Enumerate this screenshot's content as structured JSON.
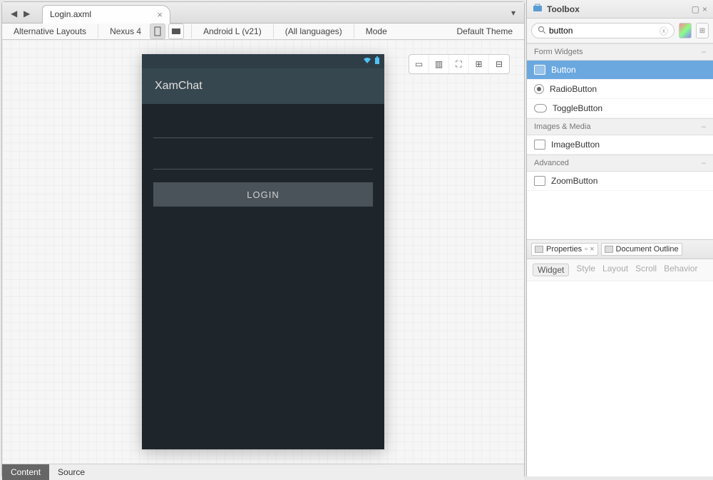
{
  "tab": {
    "filename": "Login.axml"
  },
  "toolbar": {
    "alt_layouts": "Alternative Layouts",
    "device": "Nexus 4",
    "android": "Android L (v21)",
    "languages": "(All languages)",
    "mode": "Mode",
    "theme": "Default Theme"
  },
  "phone": {
    "app_title": "XamChat",
    "login_btn": "LOGIN"
  },
  "bottom_tabs": {
    "content": "Content",
    "source": "Source"
  },
  "toolbox": {
    "title": "Toolbox",
    "search_value": "button",
    "categories": [
      {
        "name": "Form Widgets",
        "items": [
          {
            "label": "Button",
            "icon": "button",
            "selected": true
          },
          {
            "label": "RadioButton",
            "icon": "radio",
            "selected": false
          },
          {
            "label": "ToggleButton",
            "icon": "toggle",
            "selected": false
          }
        ]
      },
      {
        "name": "Images & Media",
        "items": [
          {
            "label": "ImageButton",
            "icon": "button",
            "selected": false
          }
        ]
      },
      {
        "name": "Advanced",
        "items": [
          {
            "label": "ZoomButton",
            "icon": "button",
            "selected": false
          }
        ]
      }
    ]
  },
  "properties": {
    "title": "Properties",
    "doc_outline": "Document Outline",
    "tabs": [
      "Widget",
      "Style",
      "Layout",
      "Scroll",
      "Behavior"
    ],
    "active_tab": "Widget"
  }
}
